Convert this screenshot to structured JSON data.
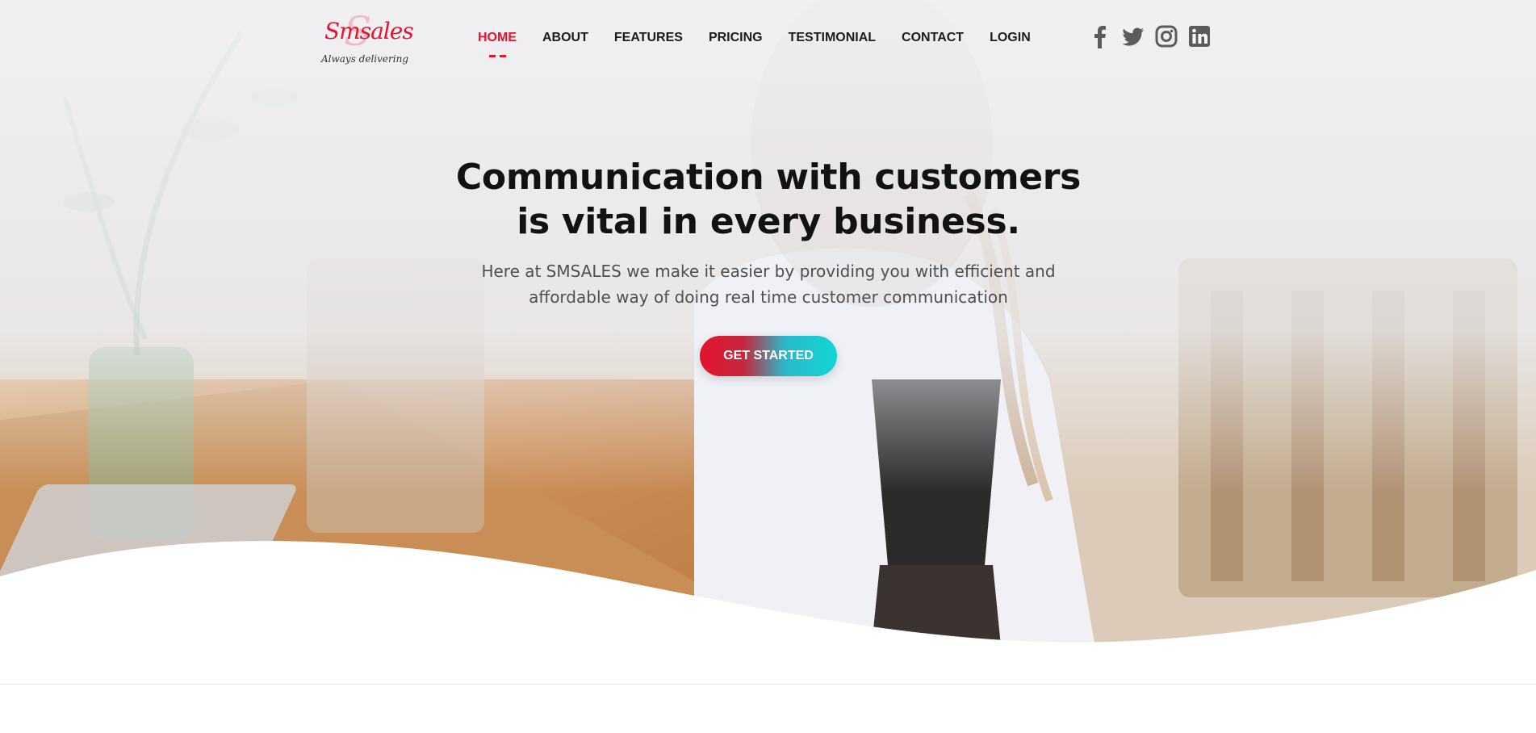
{
  "brand": {
    "logo_text": "Smsales",
    "tagline": "Always delivering",
    "accent_color": "#e4132e",
    "cta_gradient_end": "#10d6d6"
  },
  "nav": {
    "items": [
      {
        "label": "HOME",
        "active": true
      },
      {
        "label": "ABOUT",
        "active": false
      },
      {
        "label": "FEATURES",
        "active": false
      },
      {
        "label": "PRICING",
        "active": false
      },
      {
        "label": "TESTIMONIAL",
        "active": false
      },
      {
        "label": "CONTACT",
        "active": false
      },
      {
        "label": "LOGIN",
        "active": false
      }
    ]
  },
  "social": [
    {
      "icon": "facebook-icon"
    },
    {
      "icon": "twitter-icon"
    },
    {
      "icon": "instagram-icon"
    },
    {
      "icon": "linkedin-icon"
    }
  ],
  "hero": {
    "headline_line1": "Communication with customers",
    "headline_line2": "is vital in every business.",
    "subtext_line1": "Here at SMSALES we make it easier by providing you with efficient and",
    "subtext_line2": "affordable way of doing real time customer communication",
    "cta_label": "GET STARTED"
  }
}
